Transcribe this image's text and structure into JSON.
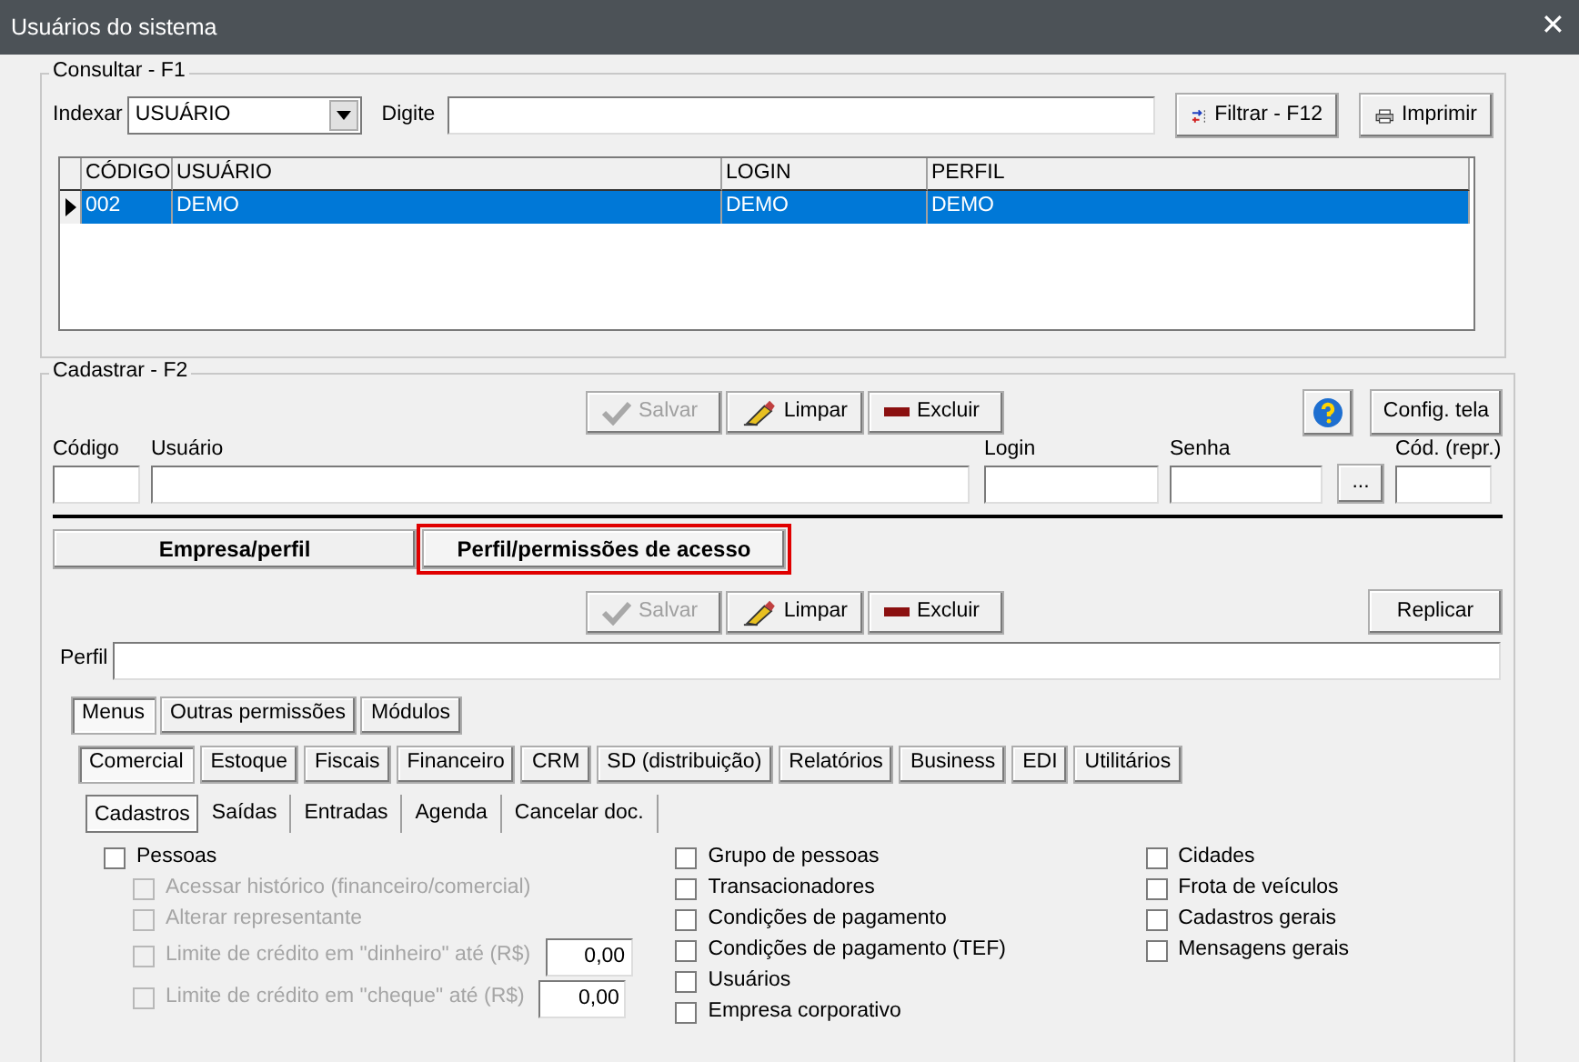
{
  "window": {
    "title": "Usuários do sistema",
    "close": "✕"
  },
  "consult": {
    "legend": "Consultar - F1",
    "index_label": "Indexar",
    "index_value": "USUÁRIO",
    "type_label": "Digite",
    "filter_button": "Filtrar - F12",
    "print_button": "Imprimir",
    "columns": [
      "CÓDIGO",
      "USUÁRIO",
      "LOGIN",
      "PERFIL"
    ],
    "rows": [
      {
        "cells": [
          "002",
          "DEMO",
          "DEMO",
          "DEMO"
        ],
        "selected": true
      }
    ]
  },
  "register": {
    "legend": "Cadastrar - F2",
    "buttons": [
      {
        "kind": "save",
        "label": "Salvar",
        "disabled": true
      },
      {
        "kind": "clear",
        "label": "Limpar",
        "disabled": false
      },
      {
        "kind": "delete",
        "label": "Excluir",
        "disabled": false
      }
    ],
    "config_button": "Config. tela",
    "fields": [
      {
        "label": "Código"
      },
      {
        "label": "Usuário"
      },
      {
        "label": "Login"
      },
      {
        "label": "Senha"
      },
      {
        "label": "Cód. (repr.)"
      }
    ],
    "lookup_button": "..."
  },
  "main_tabs": [
    {
      "label": "Empresa/perfil",
      "selected": false
    },
    {
      "label": "Perfil/permissões de acesso",
      "selected": true
    }
  ],
  "profile": {
    "buttons": [
      {
        "kind": "save",
        "label": "Salvar",
        "disabled": true
      },
      {
        "kind": "clear",
        "label": "Limpar",
        "disabled": false
      },
      {
        "kind": "delete",
        "label": "Excluir",
        "disabled": false
      }
    ],
    "replicate_button": "Replicar",
    "perfil_label": "Perfil",
    "tabs": [
      {
        "label": "Menus",
        "selected": true
      },
      {
        "label": "Outras permissões",
        "selected": false
      },
      {
        "label": "Módulos",
        "selected": false
      }
    ],
    "module_tabs": [
      {
        "label": "Comercial",
        "selected": true
      },
      {
        "label": "Estoque",
        "selected": false
      },
      {
        "label": "Fiscais",
        "selected": false
      },
      {
        "label": "Financeiro",
        "selected": false
      },
      {
        "label": "CRM",
        "selected": false
      },
      {
        "label": "SD (distribuição)",
        "selected": false
      },
      {
        "label": "Relatórios",
        "selected": false
      },
      {
        "label": "Business",
        "selected": false
      },
      {
        "label": "EDI",
        "selected": false
      },
      {
        "label": "Utilitários",
        "selected": false
      }
    ],
    "menu_tabs": [
      {
        "label": "Cadastros",
        "selected": true
      },
      {
        "label": "Saídas",
        "selected": false
      },
      {
        "label": "Entradas",
        "selected": false
      },
      {
        "label": "Agenda",
        "selected": false
      },
      {
        "label": "Cancelar doc.",
        "selected": false
      }
    ],
    "columns": [
      [
        {
          "label": "Pessoas",
          "checked": false,
          "disabled": false,
          "children": [
            {
              "label": "Acessar histórico (financeiro/comercial)",
              "checked": false,
              "disabled": true
            },
            {
              "label": "Alterar representante",
              "checked": false,
              "disabled": true
            },
            {
              "label": "Limite de crédito em \"dinheiro\" até (R$)",
              "checked": false,
              "disabled": true,
              "value": "0,00"
            },
            {
              "label": "Limite de crédito em \"cheque\" até (R$)",
              "checked": false,
              "disabled": true,
              "value": "0,00"
            }
          ]
        }
      ],
      [
        {
          "label": "Grupo de pessoas",
          "checked": false,
          "disabled": false
        },
        {
          "label": "Transacionadores",
          "checked": false,
          "disabled": false
        },
        {
          "label": "Condições de pagamento",
          "checked": false,
          "disabled": false
        },
        {
          "label": "Condições de pagamento (TEF)",
          "checked": false,
          "disabled": false
        },
        {
          "label": "Usuários",
          "checked": false,
          "disabled": false
        },
        {
          "label": "Empresa corporativo",
          "checked": false,
          "disabled": false
        }
      ],
      [
        {
          "label": "Cidades",
          "checked": false,
          "disabled": false
        },
        {
          "label": "Frota de veículos",
          "checked": false,
          "disabled": false
        },
        {
          "label": "Cadastros gerais",
          "checked": false,
          "disabled": false
        },
        {
          "label": "Mensagens gerais",
          "checked": false,
          "disabled": false
        }
      ]
    ]
  }
}
